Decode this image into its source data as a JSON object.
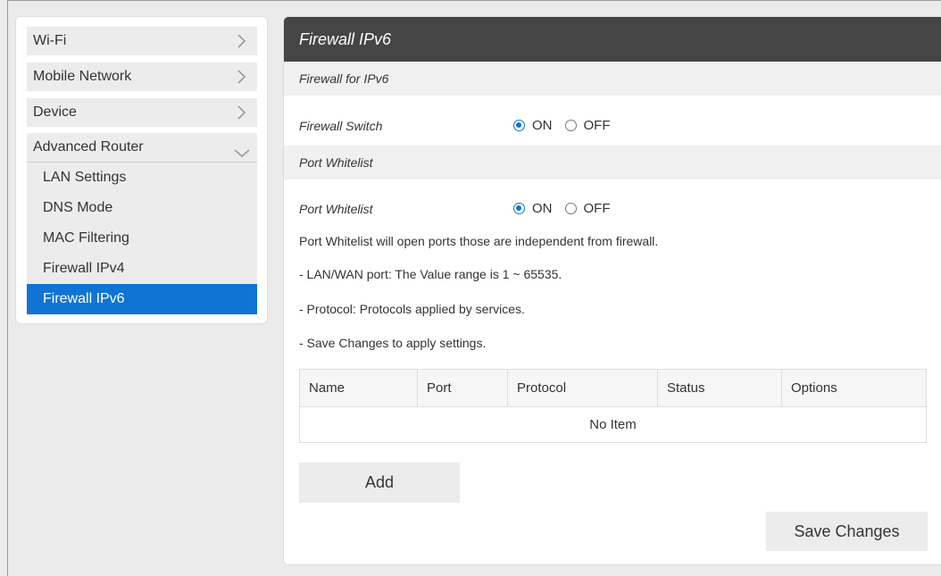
{
  "sidebar": {
    "items": [
      {
        "label": "Wi-Fi"
      },
      {
        "label": "Mobile Network"
      },
      {
        "label": "Device"
      }
    ],
    "section": {
      "label": "Advanced Router",
      "children": [
        {
          "label": "LAN Settings"
        },
        {
          "label": "DNS Mode"
        },
        {
          "label": "MAC Filtering"
        },
        {
          "label": "Firewall IPv4"
        },
        {
          "label": "Firewall IPv6",
          "active": true
        }
      ]
    }
  },
  "main": {
    "title": "Firewall IPv6",
    "section1": "Firewall for IPv6",
    "firewall_switch": {
      "label": "Firewall Switch",
      "on_label": "ON",
      "off_label": "OFF",
      "value": "ON"
    },
    "section2": "Port Whitelist",
    "port_whitelist": {
      "label": "Port Whitelist",
      "on_label": "ON",
      "off_label": "OFF",
      "value": "ON"
    },
    "info": [
      "Port Whitelist will open ports those are independent from firewall.",
      "- LAN/WAN port: The Value range is 1 ~ 65535.",
      "- Protocol: Protocols applied by services.",
      "- Save Changes to apply settings."
    ],
    "table": {
      "headers": [
        "Name",
        "Port",
        "Protocol",
        "Status",
        "Options"
      ],
      "empty_text": "No Item"
    },
    "add_label": "Add",
    "save_label": "Save Changes"
  },
  "colors": {
    "accent": "#0f74d3",
    "title_bar": "#454545",
    "background": "#ebebeb"
  }
}
